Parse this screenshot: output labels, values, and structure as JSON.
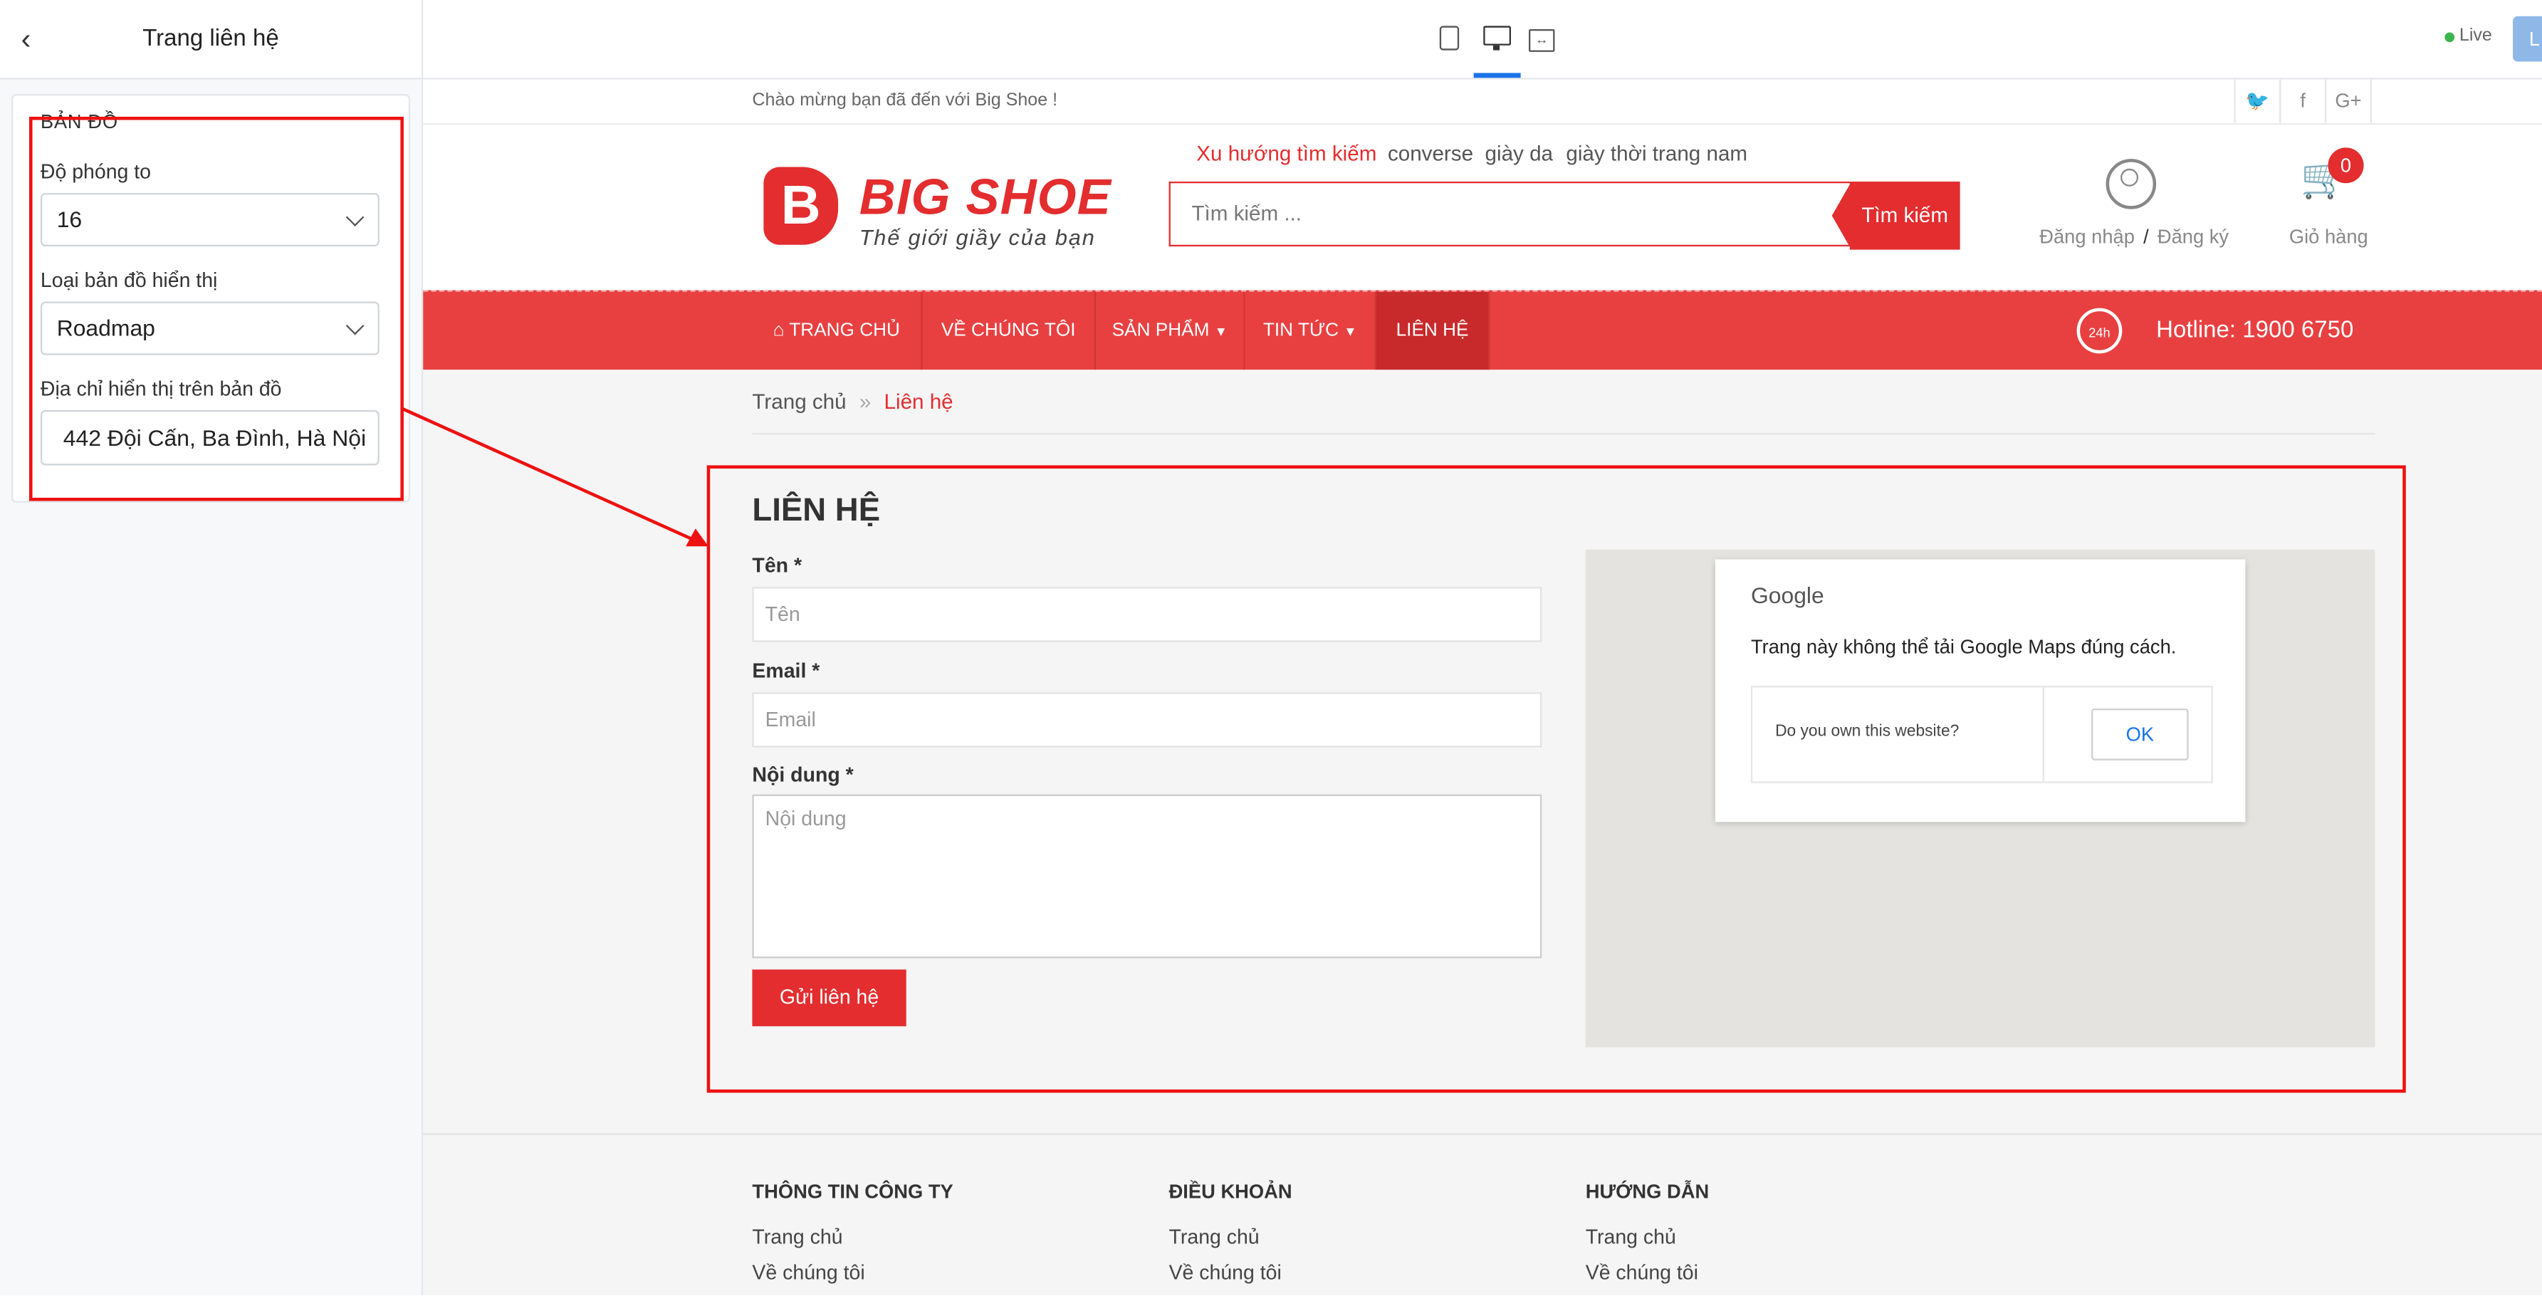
{
  "editor": {
    "panel_title": "Trang liên hệ",
    "section_title": "BẢN ĐỒ",
    "zoom_label": "Độ phóng to",
    "zoom_value": "16",
    "map_type_label": "Loại bản đồ hiển thị",
    "map_type_value": "Roadmap",
    "address_label": "Địa chỉ hiển thị trên bản đồ",
    "address_value": "442 Đội Cấn, Ba Đình, Hà Nội"
  },
  "toolbar": {
    "live_label": "Live",
    "publish_label": "L",
    "devices": [
      "mobile-icon",
      "desktop-icon",
      "fullwidth-icon"
    ]
  },
  "site": {
    "welcome": "Chào mừng bạn đã đến với Big Shoe !",
    "social": [
      "twitter-icon",
      "facebook-icon",
      "google-plus-icon"
    ],
    "social_glyphs": [
      "🐦",
      "f",
      "G+"
    ],
    "logo_letter": "B",
    "logo_name": "BIG SHOE",
    "logo_tagline": "Thế giới giầy của bạn",
    "trend_label": "Xu hướng tìm kiếm",
    "trend_tags": [
      "converse",
      "giày da",
      "giày thời trang nam"
    ],
    "search_placeholder": "Tìm kiếm ...",
    "search_button": "Tìm kiếm",
    "login": "Đăng nhập",
    "login_sep": "/",
    "register": "Đăng ký",
    "cart_count": "0",
    "cart_label": "Giỏ hàng",
    "nav": [
      "TRANG CHỦ",
      "VỀ CHÚNG TÔI",
      "SẢN PHẨM",
      "TIN TỨC",
      "LIÊN HỆ"
    ],
    "hotline_badge": "24h",
    "hotline": "Hotline: 1900 6750",
    "breadcrumb": {
      "home": "Trang chủ",
      "sep": "»",
      "current": "Liên hệ"
    },
    "contact": {
      "title": "LIÊN HỆ",
      "name_label": "Tên *",
      "name_placeholder": "Tên",
      "email_label": "Email *",
      "email_placeholder": "Email",
      "content_label": "Nội dung *",
      "content_placeholder": "Nội dung",
      "submit": "Gửi liên hệ"
    },
    "map": {
      "google": "Google",
      "error": "Trang này không thể tải Google Maps đúng cách.",
      "own_site": "Do you own this website?",
      "ok": "OK"
    },
    "footer": [
      {
        "heading": "THÔNG TIN CÔNG TY",
        "links": [
          "Trang chủ",
          "Về chúng tôi"
        ]
      },
      {
        "heading": "ĐIỀU KHOẢN",
        "links": [
          "Trang chủ",
          "Về chúng tôi"
        ]
      },
      {
        "heading": "HƯỚNG DẪN",
        "links": [
          "Trang chủ",
          "Về chúng tôi"
        ]
      }
    ]
  },
  "colors": {
    "brand_red": "#e32d2f",
    "nav_red": "#e84041",
    "annotation_red": "#ee1111",
    "accent_blue": "#1a73e8"
  }
}
